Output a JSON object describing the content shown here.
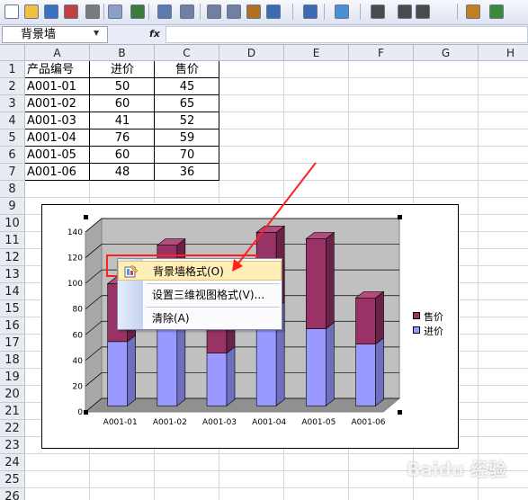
{
  "toolbar": {
    "buttons": [
      "new-icon",
      "open-icon",
      "save-icon",
      "permission-icon",
      "print-icon",
      "print-preview-icon",
      "spelling-icon",
      "research-icon",
      "cut-icon",
      "copy-icon",
      "paste-icon",
      "format-painter-icon",
      "undo-icon",
      "redo-icon",
      "hyperlink-icon",
      "autosum-icon",
      "sort-ascending-icon",
      "sort-descending-icon",
      "chart-wizard-icon",
      "drawing-icon"
    ]
  },
  "formula_bar": {
    "name_box": "背景墙",
    "fx_label": "fx",
    "formula": ""
  },
  "sheet": {
    "columns": [
      "A",
      "B",
      "C",
      "D",
      "E",
      "F",
      "G",
      "H"
    ],
    "rows": [
      "1",
      "2",
      "3",
      "4",
      "5",
      "6",
      "7",
      "8",
      "9",
      "10",
      "11",
      "12",
      "13",
      "14",
      "15",
      "16",
      "17",
      "18",
      "19",
      "20",
      "21",
      "22",
      "23",
      "24",
      "25",
      "26"
    ],
    "headers": [
      "产品编号",
      "进价",
      "售价"
    ],
    "data": [
      [
        "A001-01",
        "50",
        "45"
      ],
      [
        "A001-02",
        "60",
        "65"
      ],
      [
        "A001-03",
        "41",
        "52"
      ],
      [
        "A001-04",
        "76",
        "59"
      ],
      [
        "A001-05",
        "60",
        "70"
      ],
      [
        "A001-06",
        "48",
        "36"
      ]
    ]
  },
  "chart_data": {
    "type": "bar",
    "stacked": true,
    "three_d": true,
    "categories": [
      "A001-01",
      "A001-02",
      "A001-03",
      "A001-04",
      "A001-05",
      "A001-06"
    ],
    "series": [
      {
        "name": "进价",
        "values": [
          50,
          60,
          41,
          76,
          60,
          48
        ],
        "color": "#9999ff"
      },
      {
        "name": "售价",
        "values": [
          45,
          65,
          52,
          59,
          70,
          36
        ],
        "color": "#993366"
      }
    ],
    "y_ticks": [
      "0",
      "20",
      "40",
      "60",
      "80",
      "100",
      "120",
      "140"
    ],
    "ylim": [
      0,
      140
    ],
    "grid": true,
    "legend": "right"
  },
  "context_menu": {
    "items": [
      {
        "label": "背景墙格式(O)",
        "icon": "format-wall-icon"
      },
      {
        "label": "设置三维视图格式(V)...",
        "icon": ""
      },
      {
        "label": "清除(A)",
        "icon": ""
      }
    ]
  },
  "watermark": "Baidu 经验"
}
